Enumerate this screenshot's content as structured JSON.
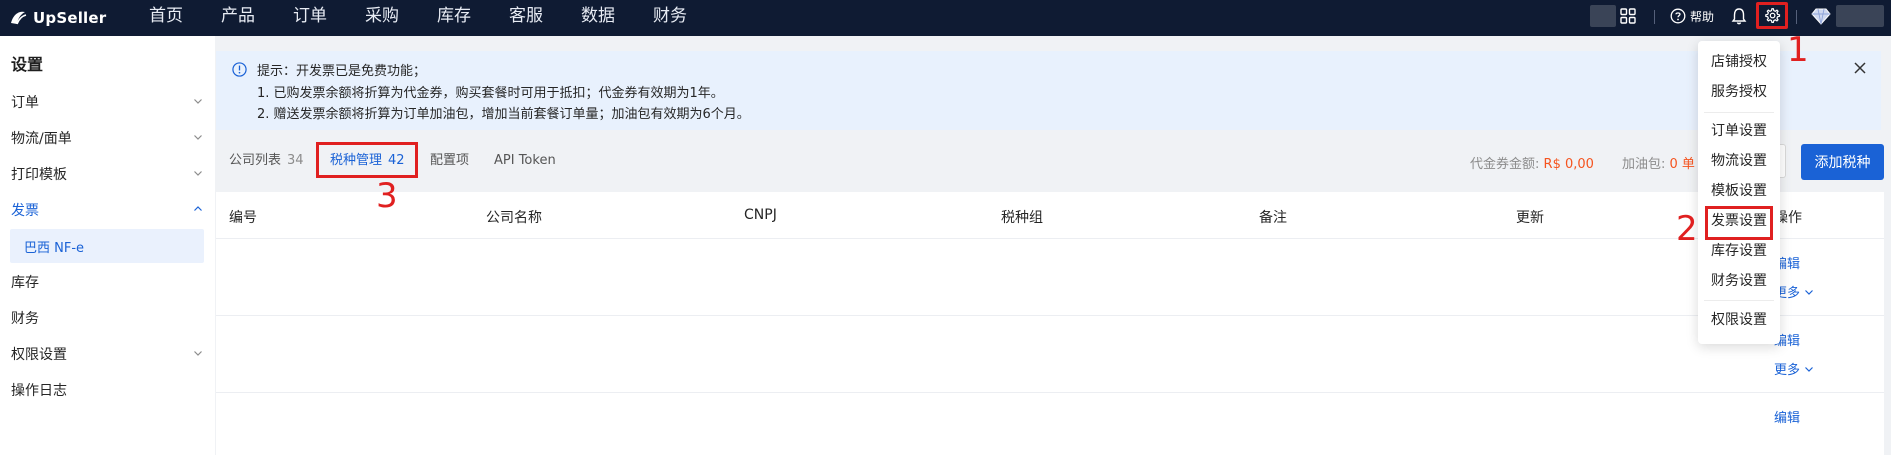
{
  "app": {
    "brand": "UpSeller"
  },
  "topnav": [
    "首页",
    "产品",
    "订单",
    "采购",
    "库存",
    "客服",
    "数据",
    "财务"
  ],
  "topbar_right": {
    "help_label": "帮助"
  },
  "sidebar": {
    "title": "设置",
    "items": [
      {
        "label": "订单",
        "chevron": "down"
      },
      {
        "label": "物流/面单",
        "chevron": "down"
      },
      {
        "label": "打印模板",
        "chevron": "down"
      },
      {
        "label": "发票",
        "chevron": "up"
      },
      {
        "label": "库存",
        "chevron": ""
      },
      {
        "label": "财务",
        "chevron": ""
      },
      {
        "label": "权限设置",
        "chevron": "down"
      },
      {
        "label": "操作日志",
        "chevron": ""
      }
    ],
    "sub_item": "巴西 NF-e"
  },
  "notice": {
    "line1": "提示：开发票已是免费功能；",
    "line2": "1. 已购发票余额将折算为代金券，购买套餐时可用于抵扣；代金券有效期为1年。",
    "line3": "2. 赠送发票余额将折算为订单加油包，增加当前套餐订单量；加油包有效期为6个月。"
  },
  "tabs": [
    {
      "label": "公司列表",
      "count": "34"
    },
    {
      "label": "税种管理",
      "count": "42"
    },
    {
      "label": "配置项",
      "count": ""
    },
    {
      "label": "API Token",
      "count": ""
    }
  ],
  "balance": {
    "coupon_label": "代金券金额:",
    "coupon_value": "R$ 0,00",
    "package_label": "加油包:",
    "package_value": "0 单"
  },
  "add_button": "添加税种",
  "table": {
    "columns": [
      "编号",
      "公司名称",
      "CNPJ",
      "税种组",
      "备注",
      "更新",
      "操作"
    ],
    "actions": {
      "edit": "编辑",
      "more": "更多"
    }
  },
  "dropdown": {
    "groups": [
      [
        "店铺授权",
        "服务授权"
      ],
      [
        "订单设置",
        "物流设置",
        "模板设置",
        "发票设置",
        "库存设置",
        "财务设置"
      ],
      [
        "权限设置"
      ]
    ]
  },
  "markers": [
    "1",
    "2",
    "3"
  ],
  "colors": {
    "topbar": "#0f1b33",
    "accent": "#1a62d6",
    "highlight": "#e02020",
    "coupon": "#f5541f"
  }
}
